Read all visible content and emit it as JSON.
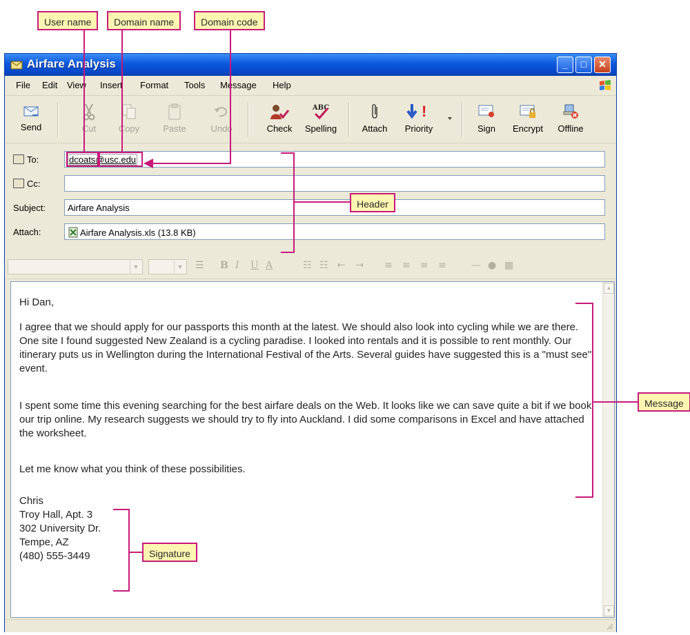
{
  "window": {
    "title": "Airfare Analysis"
  },
  "title_buttons": {
    "minimize": "_",
    "maximize": "□",
    "close": "✕"
  },
  "menu": [
    "File",
    "Edit",
    "View",
    "Insert",
    "Format",
    "Tools",
    "Message",
    "Help"
  ],
  "toolbar": {
    "send": "Send",
    "cut": "Cut",
    "copy": "Copy",
    "paste": "Paste",
    "undo": "Undo",
    "check": "Check",
    "spelling": "Spelling",
    "attach": "Attach",
    "priority": "Priority",
    "sign": "Sign",
    "encrypt": "Encrypt",
    "offline": "Offline",
    "spelling_icon_text": "ABC",
    "priority_icon_text": "!"
  },
  "header": {
    "to_label": "To:",
    "to_value": "dcoats@usc.edu",
    "cc_label": "Cc:",
    "cc_value": "",
    "subject_label": "Subject:",
    "subject_value": "Airfare Analysis",
    "attach_label": "Attach:",
    "attach_value": "Airfare Analysis.xls (13.8 KB)"
  },
  "message": {
    "greeting": "Hi Dan,",
    "para1": "I agree that we should apply for our passports this month at the latest.  We should also look into cycling while we are there. One site I found suggested New Zealand is a cycling paradise. I looked into rentals and it is possible to rent monthly. Our itinerary puts us in Wellington during the International Festival of the Arts. Several guides have suggested this is a \"must see\" event.",
    "para2": "I spent some time this evening searching for the best airfare deals on the Web.  It looks like we can save quite a bit if we book our trip online. My research suggests we should try to fly into Auckland. I did some comparisons in Excel and have attached the worksheet.",
    "closing": "Let me know what you think of these possibilities."
  },
  "signature": {
    "line1": "Chris",
    "line2": "Troy Hall, Apt. 3",
    "line3": "302 University Dr.",
    "line4": "Tempe, AZ",
    "line5": "(480) 555-3449"
  },
  "callouts": {
    "user_name": "User name",
    "domain_name": "Domain name",
    "domain_code": "Domain code",
    "header": "Header",
    "message": "Message",
    "signature": "Signature"
  },
  "format_toolbar": {
    "bold": "B",
    "italic": "I",
    "underline": "U",
    "font_color": "A"
  },
  "colors": {
    "accent": "#c8197a",
    "callout_fill": "#fdf6b2",
    "titlebar": "#0a58dc"
  }
}
